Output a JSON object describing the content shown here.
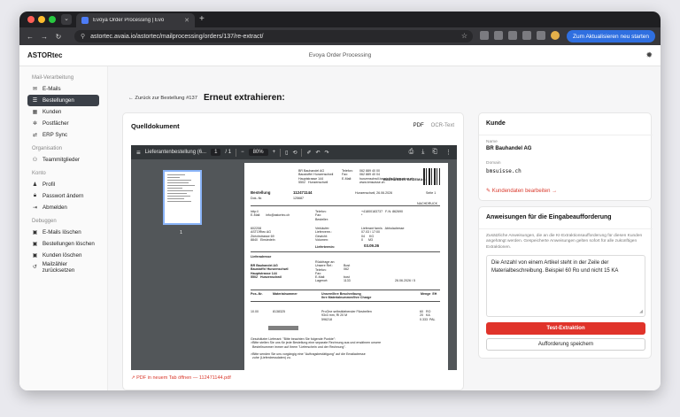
{
  "browser": {
    "tab_title": "Evoya Order Processing | Evo",
    "new_tab": "+",
    "url": "astortec.avaia.io/astortec/mailprocessing/orders/137/re-extract/",
    "update_button": "Zum Aktualisieren neu starten"
  },
  "header": {
    "brand": "ASTORtec",
    "title": "Evoya Order Processing"
  },
  "sidebar": {
    "sections": [
      {
        "title": "Mail-Verarbeitung",
        "items": [
          {
            "label": "E-Mails",
            "icon": "mail-icon",
            "active": false
          },
          {
            "label": "Bestellungen",
            "icon": "list-icon",
            "active": true
          },
          {
            "label": "Kunden",
            "icon": "building-icon",
            "active": false
          },
          {
            "label": "Postfächer",
            "icon": "gear-icon",
            "active": false
          },
          {
            "label": "ERP Sync",
            "icon": "sync-icon",
            "active": false
          }
        ]
      },
      {
        "title": "Organisation",
        "items": [
          {
            "label": "Teammitglieder",
            "icon": "users-icon",
            "active": false
          }
        ]
      },
      {
        "title": "Konto",
        "items": [
          {
            "label": "Profil",
            "icon": "user-icon",
            "active": false
          },
          {
            "label": "Passwort ändern",
            "icon": "lock-icon",
            "active": false
          },
          {
            "label": "Abmelden",
            "icon": "logout-icon",
            "active": false
          }
        ]
      },
      {
        "title": "Debuggen",
        "items": [
          {
            "label": "E-Mails löschen",
            "icon": "trash-icon",
            "active": false
          },
          {
            "label": "Bestellungen löschen",
            "icon": "trash-icon",
            "active": false
          },
          {
            "label": "Kunden löschen",
            "icon": "trash-icon",
            "active": false
          },
          {
            "label": "Mailzähler zurücksetzen",
            "icon": "reset-icon",
            "active": false
          }
        ]
      }
    ]
  },
  "main": {
    "back_link": "← Zurück zur Bestellung #137",
    "page_title": "Erneut extrahieren:",
    "doc_panel": {
      "title": "Quelldokument",
      "tab_pdf": "PDF",
      "tab_ocr": "OCR-Text",
      "viewer": {
        "file_name": "Lieferantenbestellung (6...",
        "page_current": "1",
        "page_total": "/ 1",
        "zoom": "80%",
        "thumb_number": "1"
      },
      "pdf_link": "↗ PDF in neuem Tab öffnen — 112471144.pdf"
    }
  },
  "pdf": {
    "sender": "BR Bauhandel AG\nBaustoffe/ Hunzenschwil\nHauptstrasse 144\n5502   Hunzenschwil",
    "contact_labels": "Telefon:\nFax:\nE-Mail:",
    "contact_values": "062 889 40 00\n062 889 40 04\nhunzenschwil.baustoffe@bmsuisse.ch\nwww.bmsuisse.ch",
    "logo": "BAUHANDEL BRZEMAG",
    "order_label": "Bestellung",
    "order_number": "112471144",
    "order_place_date": "Hunzenschwil, 26.06.2026",
    "page_label": "Seite 1",
    "dok_label": "Dok.-Nr.",
    "dok_number": "125687",
    "nachdruck": "NACHDRUCK",
    "http_block": "http://\nE-Mail:      info@astortec.ch",
    "tel_block": "Telefon:\nFax:\nBesteller:",
    "tel_values": "+41800183737   F-N: 862690\n*",
    "supplier": "602208\nASTORtec AG\nZürichstrasse 69\n8840   Einsiedeln",
    "verkaufer_labels": "Verkäufer:\nLieferverm.:\nGewicht:\nVolumen:",
    "verkaufer_values": "Lieferant fam/s   Abholadresse\n07.03 / 17:00\n04     KG\n0      M3",
    "liefertermin_label": "Liefertermin:",
    "liefertermin_value": "03.09.26",
    "lieferadresse_label": "Lieferadresse",
    "lieferadresse": "BR Bauhandel AG\nBaustoffe/ Hunzenschwil\nHauptstrasse 144\n5502   Hunzenschwil",
    "ruckfrage_labels": "Rückfrage an:\nUnsere Ref.:\nTelefon:\nFax:\nE-Mail:\nLagerort:",
    "ruckfrage_values": "Bost\n062\n\nbost\n1133",
    "ruckfrage_date": "26.06.2026 / 5",
    "table_head_pos": "Pos.-Nr.",
    "table_head_mat": "Materialnummer",
    "table_head_desc": "Unsere/Ihre Beschreibung\nIhre Materialnummer/Ihre Charge",
    "table_head_qty": "Menge  EH",
    "row_pos": "10.00",
    "row_mat": "8138325",
    "row_desc": "ProOne selbstklebender Filzstreifen\n93x3 mm, Rl 20 M\n596218",
    "row_qty": "60   RO\n20   KA\n0.333  PAL",
    "footer_text": "Geschätzter Lieferant: \"Bitte beachten Sie folgende Punkte\":\n>Bitte stellen Sie uns für jede Bestellung eine separate Rechnung aus und erwähnen unsere\n  Bestellnummer immer auf Ihrem \"Lieferschein und der Rechnung\".\n\n>Bitte senden Sie uns vorgängig eine \"Auftragsbestätigung\" auf die Emailadresse\n  zuhe (Lieferdressdaten) zu."
  },
  "kunde": {
    "title": "Kunde",
    "name_label": "Name",
    "name_value": "BR Bauhandel AG",
    "domain_label": "Domain",
    "domain_value": "bmsuisse.ch",
    "edit_link": "✎ Kundendaten bearbeiten →"
  },
  "instructions": {
    "title": "Anweisungen für die Eingabeaufforderung",
    "description": "Zusätzliche Anweisungen, die an die KI-Extraktionsaufforderung für diesen Kunden angehängt werden. Gespeicherte Anweisungen gelten sofort für alle zukünftigen Extraktionen.",
    "text": "Die Anzahl von einem Artikel steht in der Zeile der Materialbeschreibung. Beispiel 60 Ro und nicht 15 KA",
    "test_button": "Test-Extraktion",
    "save_button": "Aufforderung speichern"
  },
  "colors": {
    "accent_red": "#e0332a",
    "sidebar_active": "#3b4048",
    "browser_blue": "#2f6fe0"
  }
}
